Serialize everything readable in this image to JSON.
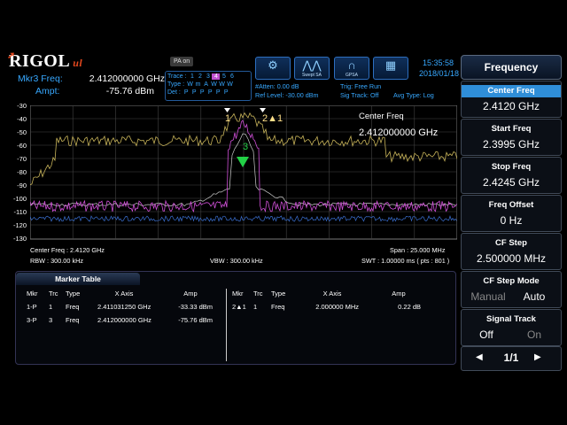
{
  "header": {
    "logo_text": "RIGOL",
    "logo_suffix": "ul",
    "pa_label": "PA on",
    "marker_freq_label": "Mkr3 Freq:",
    "marker_freq_value": "2.412000000 GHz",
    "marker_ampt_label": "Ampt:",
    "marker_ampt_value": "-75.76 dBm",
    "trace_label": "Trace :",
    "type_label": "Type :",
    "det_label": "Det :",
    "trace_numbers": [
      "1",
      "2",
      "3",
      "4",
      "5",
      "6"
    ],
    "trace_types": [
      "W",
      "m",
      "A",
      "W",
      "W",
      "W"
    ],
    "trace_dets": [
      "P",
      "P",
      "P",
      "P",
      "P",
      "P"
    ],
    "atten": "#Atten: 0.00 dB",
    "ref_level": "Ref Level: -30.00 dBm",
    "trig": "Trig: Free Run",
    "sig_track": "Sig Track: Off",
    "avg_type": "Avg Type: Log",
    "time": "15:35:58",
    "date": "2018/01/18",
    "icon_buttons": [
      {
        "icon": "gear-icon",
        "caption": ""
      },
      {
        "icon": "swept-sa-icon",
        "caption": "Swept SA"
      },
      {
        "icon": "gpsa-icon",
        "caption": "GPSA"
      },
      {
        "icon": "grid-layout-icon",
        "caption": ""
      }
    ]
  },
  "plot": {
    "y_ticks": [
      "-30",
      "-40",
      "-50",
      "-60",
      "-70",
      "-80",
      "-90",
      "-100",
      "-110",
      "-120",
      "-130"
    ],
    "annot_title": "Center Freq",
    "annot_value": "2.412000000 GHz",
    "marker_labels": [
      "1",
      "2▲1",
      "3"
    ],
    "colors": {
      "trace1": "#c8b45a",
      "trace2": "#d050d8",
      "trace3": "#cccccc",
      "trace4": "#3a6fd0",
      "marker_green": "#22d046"
    }
  },
  "footer": {
    "center_freq": "Center Freq : 2.4120 GHz",
    "span": "Span : 25.000 MHz",
    "rbw": "RBW : 300.00 kHz",
    "vbw": "VBW : 300.00 kHz",
    "swt": "SWT : 1.00000 ms ( pts : 801 )"
  },
  "marker_table": {
    "title": "Marker Table",
    "headers": [
      "Mkr",
      "Trc",
      "Type",
      "X Axis",
      "Amp"
    ],
    "left_rows": [
      [
        "1-P",
        "1",
        "Freq",
        "2.411031250 GHz",
        "-33.33 dBm"
      ],
      [
        "3-P",
        "3",
        "Freq",
        "2.412000000 GHz",
        "-75.76 dBm"
      ]
    ],
    "right_rows": [
      [
        "2▲1",
        "1",
        "Freq",
        "2.000000 MHz",
        "0.22 dB"
      ]
    ]
  },
  "menu": {
    "title": "Frequency",
    "items": [
      {
        "label": "Center Freq",
        "value": "2.4120 GHz",
        "selected": true
      },
      {
        "label": "Start Freq",
        "value": "2.3995 GHz",
        "selected": false
      },
      {
        "label": "Stop Freq",
        "value": "2.4245 GHz",
        "selected": false
      },
      {
        "label": "Freq Offset",
        "value": "0 Hz",
        "selected": false
      },
      {
        "label": "CF Step",
        "value": "2.500000 MHz",
        "selected": false
      },
      {
        "label": "CF Step Mode",
        "value_a": "Manual",
        "value_b": "Auto",
        "selected": false
      },
      {
        "label": "Signal Track",
        "value_a": "Off",
        "value_b": "On",
        "selected": false
      }
    ],
    "page": "1/1"
  }
}
